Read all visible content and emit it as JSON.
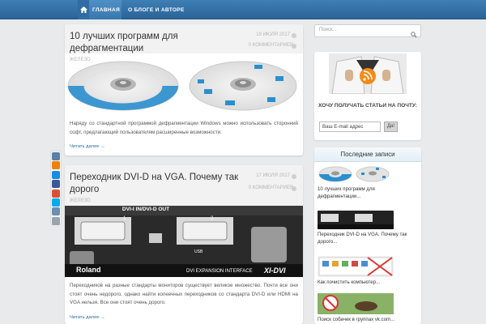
{
  "nav": {
    "home": "Главная",
    "about": "О блоге и авторе"
  },
  "posts": [
    {
      "title": "10 лучших программ для дефрагментации",
      "date": "19 июля 2017",
      "category": "Железо",
      "comments": "0 комментариев",
      "excerpt": "Наряду со стандартной программой дефрагментации Windows можно использовать сторонний софт, предлагающий пользователям расширенные возможности.",
      "more": "Читать далее →"
    },
    {
      "title": "Переходник DVI-D на VGA. Почему так дорого",
      "date": "17 июля 2017",
      "category": "Железо",
      "comments": "0 комментариев",
      "excerpt": "Переходников на разные стандарты мониторов существует великое множество. Почти все они стоят очень недорого, однако найти копеечных переходников со стандарта DVI-D или HDMI на VGA нельзя. Все они стоят очень дорого.",
      "more": "Читать далее →",
      "image_text": {
        "header": "DVI-I IN/DVI-D OUT",
        "port1": "1",
        "port2": "2",
        "usb": "USB",
        "brand": "Roland",
        "footer": "DVI EXPANSION INTERFACE",
        "model": "XI-DVI"
      }
    }
  ],
  "sidebar": {
    "search_placeholder": "Поиск...",
    "subscribe_title": "Хочу получать статьи на почту:",
    "email_placeholder": "Ваш E-mail адрес",
    "subscribe_button": "Да!",
    "recent_header": "Последние записи",
    "recent": [
      {
        "title": "10 лучших программ для дефрагментации..."
      },
      {
        "title": "Переходник DVI-D на VGA. Почему так дорого..."
      },
      {
        "title": "Как почистить компьютер..."
      },
      {
        "title": "Поиск собачек в группах vk.com..."
      }
    ]
  },
  "colors": {
    "accent": "#2b6497",
    "link": "#2b6aa0",
    "disk_blue": "#2a8fcf"
  },
  "share_icons": [
    "vk-icon",
    "odnoklassniki-icon",
    "mailru-icon",
    "facebook-icon",
    "googleplus-icon",
    "twitter-icon",
    "livejournal-icon",
    "rss-icon"
  ]
}
